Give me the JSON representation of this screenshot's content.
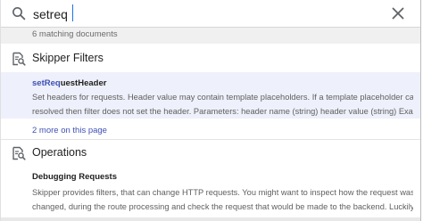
{
  "search": {
    "query": "setreq",
    "placeholder": ""
  },
  "match_count_text": "6 matching documents",
  "sections": [
    {
      "title": "Skipper Filters",
      "icon": "search-document-icon",
      "results": [
        {
          "title_highlight": "setReq",
          "title_rest": "uestHeader",
          "snippet_line1": "Set headers for requests. Header value may contain template placeholders. If a template placeholder can't be",
          "snippet_line2": "resolved then filter does not set the header. Parameters: header name (string) header value (string) Example..."
        }
      ],
      "more_link": "2 more on this page"
    },
    {
      "title": "Operations",
      "icon": "search-document-icon",
      "results": [
        {
          "title": "Debugging Requests",
          "snippet_line1": "Skipper provides filters, that can change HTTP requests. You might want to inspect how the request was",
          "snippet_line2": "changed, during the route processing and check the request that would be made to the backend. Luckily with..."
        }
      ]
    }
  ],
  "colors": {
    "accent": "#3f51b5",
    "caret": "#1a73e8",
    "highlight_bg": "#eef0fb",
    "match_bar_bg": "#f0f0f0"
  }
}
